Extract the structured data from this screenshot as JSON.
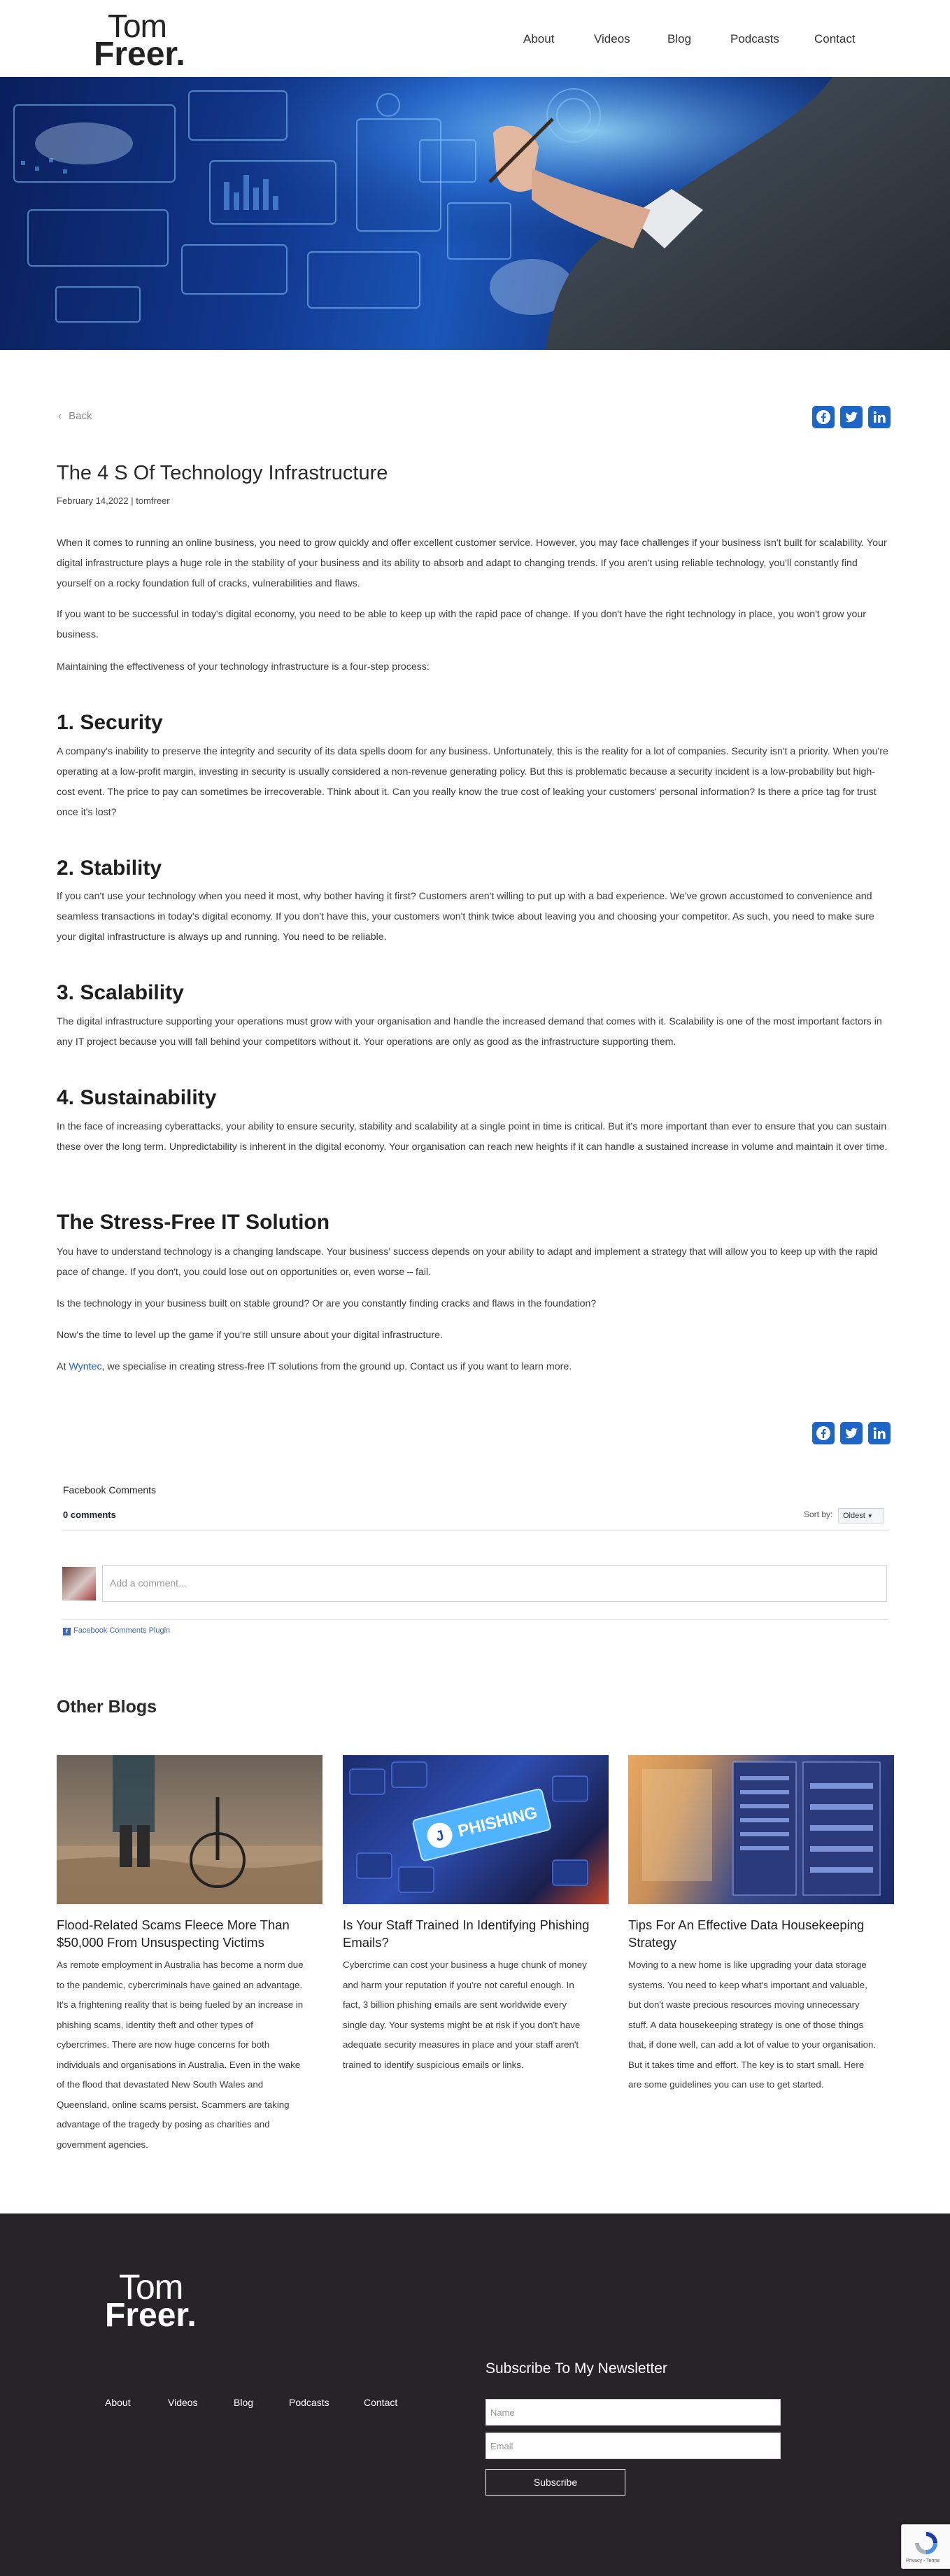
{
  "header": {
    "logo_line1": "Tom",
    "logo_line2": "Freer.",
    "nav": [
      "About",
      "Videos",
      "Blog",
      "Podcasts",
      "Contact"
    ]
  },
  "article": {
    "back_label": "Back",
    "share_icons": [
      "facebook-icon",
      "twitter-icon",
      "linkedin-icon"
    ],
    "title": "The 4 S Of Technology Infrastructure",
    "meta": "February 14,2022 | tomfreer",
    "intro": [
      "When it comes to running an online business, you need to grow quickly and offer excellent customer service. However, you may face challenges if your business isn't built for scalability. Your digital infrastructure plays a huge role in the stability of your business and its ability to absorb and adapt to changing trends. If you aren't using reliable technology, you'll constantly find yourself on a rocky foundation full of cracks, vulnerabilities and flaws.",
      "If you want to be successful in today's digital economy, you need to be able to keep up with the rapid pace of change. If you don't have the right technology in place, you won't grow your business.",
      "Maintaining the effectiveness of your technology infrastructure is a four-step process:"
    ],
    "sections": [
      {
        "heading": "1. Security",
        "text": "A company's inability to preserve the integrity and security of its data spells doom for any business. Unfortunately, this is the reality for a lot of companies. Security isn't a priority. When you're operating at a low-profit margin, investing in security is usually considered a non-revenue generating policy. But this is problematic because a security incident is a low-probability but high-cost event. The price to pay can sometimes be irrecoverable. Think about it. Can you really know the true cost of leaking your customers' personal information? Is there a price tag for trust once it's lost?"
      },
      {
        "heading": "2. Stability",
        "text": "If you can't use your technology when you need it most, why bother having it first? Customers aren't willing to put up with a bad experience. We've grown accustomed to convenience and seamless transactions in today's digital economy. If you don't have this, your customers won't think twice about leaving you and choosing your competitor. As such, you need to make sure your digital infrastructure is always up and running. You need to be reliable."
      },
      {
        "heading": "3. Scalability",
        "text": "The digital infrastructure supporting your operations must grow with your organisation and handle the increased demand that comes with it. Scalability is one of the most important factors in any IT project because you will fall behind your competitors without it. Your operations are only as good as the infrastructure supporting them."
      },
      {
        "heading": "4. Sustainability",
        "text": "In the face of increasing cyberattacks, your ability to ensure security, stability and scalability at a single point in time is critical. But it's more important than ever to ensure that you can sustain these over the long term. Unpredictability is inherent in the digital economy. Your organisation can reach new heights if it can handle a sustained increase in volume and maintain it over time."
      }
    ],
    "solution_heading": "The Stress-Free IT Solution",
    "solution": [
      "You have to understand technology is a changing landscape. Your business' success depends on your ability to adapt and implement a strategy that will allow you to keep up with the rapid pace of change. If you don't, you could lose out on opportunities or, even worse – fail.",
      "Is the technology in your business built on stable ground? Or are you constantly finding cracks and flaws in the foundation?",
      "Now's the time to level up the game if you're still unsure about your digital infrastructure."
    ],
    "closing_prefix": "At ",
    "closing_link": "Wyntec",
    "closing_suffix": ", we specialise in creating stress-free IT solutions from the ground up. Contact us if you want to learn more."
  },
  "comments": {
    "title": "Facebook Comments",
    "count": "0 comments",
    "sort_label": "Sort by",
    "sort_value": "Oldest",
    "placeholder": "Add a comment...",
    "plugin_label": "Facebook Comments Plugin"
  },
  "other_blogs": {
    "title": "Other Blogs",
    "cards": [
      {
        "title": "Flood-Related Scams Fleece More Than $50,000 From Unsuspecting Victims",
        "text": "As remote employment in Australia has become a norm due to the pandemic, cybercriminals have gained an advantage. It's a frightening reality that is being fueled by an increase in phishing scams, identity theft and other types of cybercrimes. There are now huge concerns for both individuals and organisations in Australia. Even in the wake of the flood that devastated New South Wales and Queensland, online scams persist. Scammers are taking advantage of the tragedy by posing as charities and government agencies."
      },
      {
        "title": "Is Your Staff Trained In Identifying Phishing Emails?",
        "text": "Cybercrime can cost your business a huge chunk of money and harm your reputation if you're not careful enough. In fact, 3 billion phishing emails are sent worldwide every single day. Your systems might be at risk if you don't have adequate security measures in place and your staff aren't trained to identify suspicious emails or links.",
        "image_text": "PHISHING"
      },
      {
        "title": "Tips For An Effective Data Housekeeping Strategy",
        "text": "Moving to a new home is like upgrading your data storage systems. You need to keep what's important and valuable, but don't waste precious resources moving unnecessary stuff. A data housekeeping strategy is one of those things that, if done well, can add a lot of value to your organisation. But it takes time and effort. The key is to start small. Here are some guidelines you can use to get started."
      }
    ]
  },
  "footer": {
    "logo_line1": "Tom",
    "logo_line2": "Freer.",
    "nav": [
      "About",
      "Videos",
      "Blog",
      "Podcasts",
      "Contact"
    ],
    "newsletter_title": "Subscribe To My Newsletter",
    "name_placeholder": "Name",
    "email_placeholder": "Email",
    "subscribe_label": "Subscribe",
    "recaptcha_text": "Privacy - Terms"
  },
  "colors": {
    "share": "#1d66c8",
    "link": "#1a5fc0",
    "footer_bg": "#262426"
  }
}
